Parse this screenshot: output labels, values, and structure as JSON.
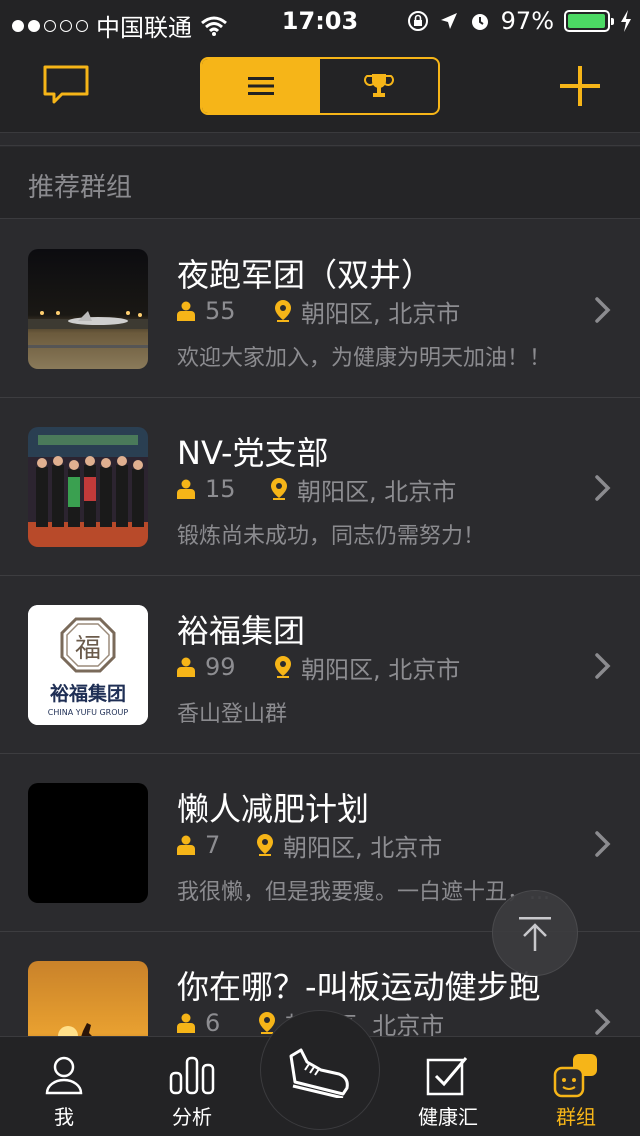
{
  "status_bar": {
    "carrier": "中国联通",
    "time": "17:03",
    "battery": "97%",
    "battery_level": 0.97
  },
  "nav": {
    "active_segment": "list",
    "segments": [
      "list-icon",
      "trophy-icon"
    ]
  },
  "section": {
    "title": "推荐群组"
  },
  "groups": [
    {
      "name": "夜跑军团（双井）",
      "members": "55",
      "location": "朝阳区, 北京市",
      "desc": "欢迎大家加入，为健康为明天加油！！"
    },
    {
      "name": "NV-党支部",
      "members": "15",
      "location": "朝阳区, 北京市",
      "desc": "锻炼尚未成功，同志仍需努力！"
    },
    {
      "name": "裕福集团",
      "members": "99",
      "location": "朝阳区, 北京市",
      "desc": "香山登山群",
      "logo_cn": "裕福集团",
      "logo_en": "CHINA YUFU GROUP",
      "logo_char": "福"
    },
    {
      "name": "懒人减肥计划",
      "members": "7",
      "location": "朝阳区, 北京市",
      "desc": "我很懒，但是我要瘦。一白遮十丑，..."
    },
    {
      "name": "你在哪？-叫板运动健步跑",
      "members": "6",
      "location": "朝阳区, 北京市",
      "desc": ""
    }
  ],
  "tabs": [
    {
      "label": "我",
      "icon": "person-icon"
    },
    {
      "label": "分析",
      "icon": "bar-chart-icon"
    },
    {
      "label": "健康汇",
      "icon": "checkbox-icon"
    },
    {
      "label": "群组",
      "icon": "group-faces-icon"
    }
  ],
  "colors": {
    "accent": "#f6b518",
    "background": "#2b2b2e"
  }
}
